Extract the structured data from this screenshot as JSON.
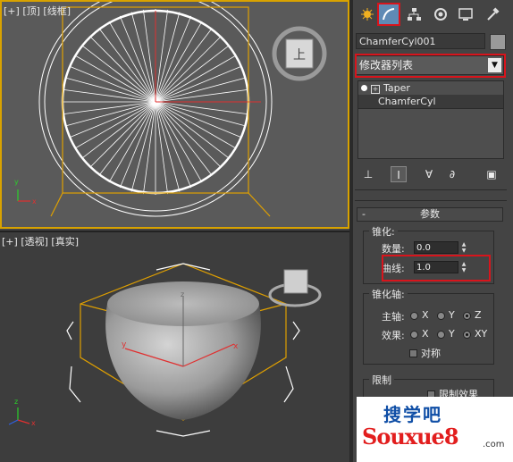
{
  "viewports": {
    "top": {
      "label_parts": [
        "[+]",
        "[顶]",
        "[线框]"
      ],
      "viewcube_label": "上"
    },
    "perspective": {
      "label_parts": [
        "[+]",
        "[透视]",
        "[真实]"
      ]
    }
  },
  "command_panel": {
    "tabs": [
      "create-icon",
      "modify-icon",
      "hierarchy-icon",
      "motion-icon",
      "display-icon",
      "utilities-icon"
    ],
    "object_name": "ChamferCyl001",
    "modifier_list": "修改器列表",
    "stack": [
      {
        "label": "Taper"
      },
      {
        "label": "ChamferCyl"
      }
    ],
    "parameters": {
      "title": "参数",
      "taper": {
        "title": "锥化:",
        "amount_label": "数量:",
        "amount_value": "0.0",
        "curve_label": "曲线:",
        "curve_value": "1.0"
      },
      "taper_axis": {
        "title": "锥化轴:",
        "primary_label": "主轴:",
        "primary_options": [
          "X",
          "Y",
          "Z"
        ],
        "primary_selected": "Z",
        "effect_label": "效果:",
        "effect_options": [
          "X",
          "Y",
          "XY"
        ],
        "effect_selected": "XY",
        "symmetry_label": "对称"
      },
      "limits": {
        "title": "限制",
        "limit_effect_label": "限制效果"
      }
    }
  },
  "watermark": {
    "cn": "搜学吧",
    "en": "Souxue8",
    "com": ".com"
  },
  "colors": {
    "selection_yellow": "#d8a200",
    "highlight_red": "#d8141c",
    "active_tab": "#5f8ab5"
  }
}
